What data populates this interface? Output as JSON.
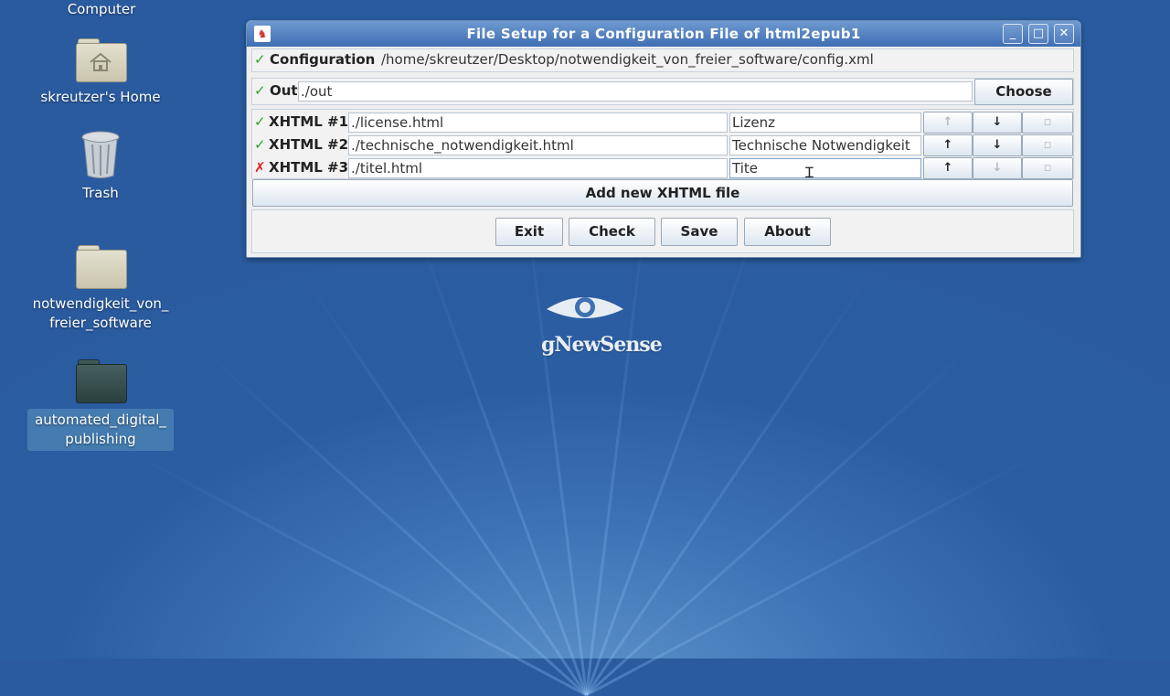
{
  "desktop": {
    "icons": [
      {
        "label": "Computer"
      },
      {
        "label": "skreutzer's Home"
      },
      {
        "label": "Trash"
      },
      {
        "label": "notwendigkeit_von_\nfreier_software"
      },
      {
        "label": "automated_digital_\npublishing"
      }
    ],
    "logo_text": "gNewSense"
  },
  "window": {
    "title": "File Setup for a Configuration File of html2epub1",
    "controls": {
      "minimize": "_",
      "maximize": "□",
      "close": "✕"
    },
    "configuration": {
      "label": "Configuration",
      "value": "/home/skreutzer/Desktop/notwendigkeit_von_freier_software/config.xml",
      "status": "✓"
    },
    "out": {
      "label": "Out",
      "value": "./out",
      "status": "✓",
      "choose_label": "Choose"
    },
    "xhtml_files": [
      {
        "label": "XHTML #1",
        "path": "./license.html",
        "title": "Lizenz",
        "status": "✓",
        "up": "↑",
        "down": "↓",
        "remove": "▫",
        "up_enabled": false,
        "down_enabled": true
      },
      {
        "label": "XHTML #2",
        "path": "./technische_notwendigkeit.html",
        "title": "Technische Notwendigkeit",
        "status": "✓",
        "up": "↑",
        "down": "↓",
        "remove": "▫",
        "up_enabled": true,
        "down_enabled": true
      },
      {
        "label": "XHTML #3",
        "path": "./titel.html",
        "title": "Tite",
        "status": "✗",
        "up": "↑",
        "down": "↓",
        "remove": "▫",
        "up_enabled": true,
        "down_enabled": false
      }
    ],
    "add_label": "Add new XHTML file",
    "buttons": {
      "exit": "Exit",
      "check": "Check",
      "save": "Save",
      "about": "About"
    }
  },
  "colors": {
    "ok": "#2aa52a",
    "error": "#dd2222",
    "titlebar": "#4a79b9"
  }
}
